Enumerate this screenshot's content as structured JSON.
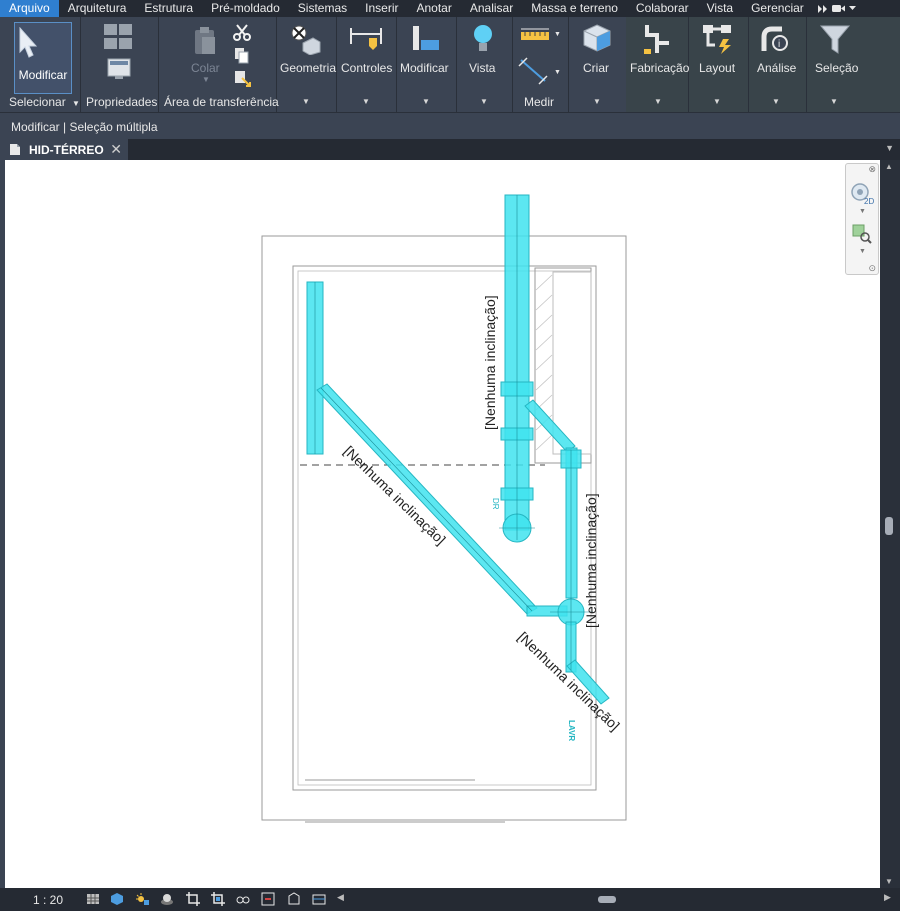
{
  "menu": {
    "tabs": [
      "Arquivo",
      "Arquitetura",
      "Estrutura",
      "Pré-moldado",
      "Sistemas",
      "Inserir",
      "Anotar",
      "Analisar",
      "Massa e terreno",
      "Colaborar",
      "Vista",
      "Gerenciar"
    ],
    "active": "Arquivo"
  },
  "ribbon": {
    "modificar": "Modificar",
    "selecionar": "Selecionar",
    "propriedades": "Propriedades",
    "colar": "Colar",
    "area_transferencia": "Área de transferência",
    "geometria": "Geometria",
    "controles": "Controles",
    "modificar2": "Modificar",
    "vista": "Vista",
    "medir": "Medir",
    "criar": "Criar",
    "fabricacao": "Fabricação",
    "layout": "Layout",
    "analise": "Análise",
    "selecao": "Seleção"
  },
  "context_bar": "Modificar | Seleção múltipla",
  "document_tab": "HID-TÉRREO",
  "drawing": {
    "slope_label": "[Nenhuma inclinação]",
    "label_dr": "DR",
    "label_lavr": "LAVR",
    "pipe_color": "#3fe3ee",
    "pipe_stroke": "#25b6c2"
  },
  "status": {
    "scale": "1 : 20"
  }
}
